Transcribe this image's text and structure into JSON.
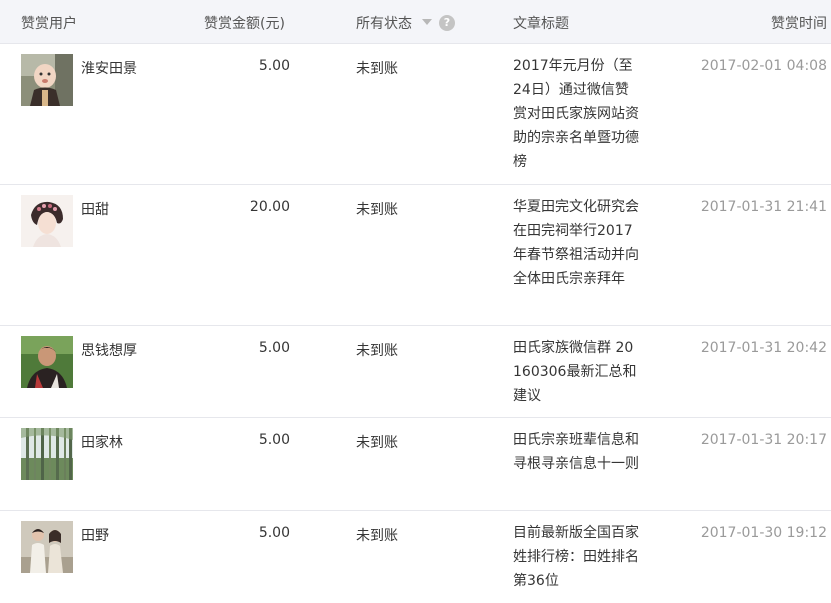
{
  "header": {
    "user": "赞赏用户",
    "amount": "赞赏金额(元)",
    "status": "所有状态",
    "status_help": "?",
    "title": "文章标题",
    "time": "赞赏时间"
  },
  "rows": [
    {
      "name": "淮安田景",
      "amount": "5.00",
      "status": "未到账",
      "title": "2017年元月份（至24日）通过微信赞赏对田氏家族网站资助的宗亲名单暨功德榜",
      "time": "2017-02-01 04:08"
    },
    {
      "name": "田甜",
      "amount": "20.00",
      "status": "未到账",
      "title": "华夏田完文化研究会在田完祠举行2017年春节祭祖活动并向全体田氏宗亲拜年",
      "time": "2017-01-31 21:41"
    },
    {
      "name": "思钱想厚",
      "amount": "5.00",
      "status": "未到账",
      "title": "田氏家族微信群 20160306最新汇总和建议",
      "time": "2017-01-31 20:42"
    },
    {
      "name": "田家林",
      "amount": "5.00",
      "status": "未到账",
      "title": "田氏宗亲班辈信息和寻根寻亲信息十一则",
      "time": "2017-01-31 20:17"
    },
    {
      "name": "田野",
      "amount": "5.00",
      "status": "未到账",
      "title": "目前最新版全国百家姓排行榜：田姓排名第36位",
      "time": "2017-01-30 19:12"
    }
  ]
}
